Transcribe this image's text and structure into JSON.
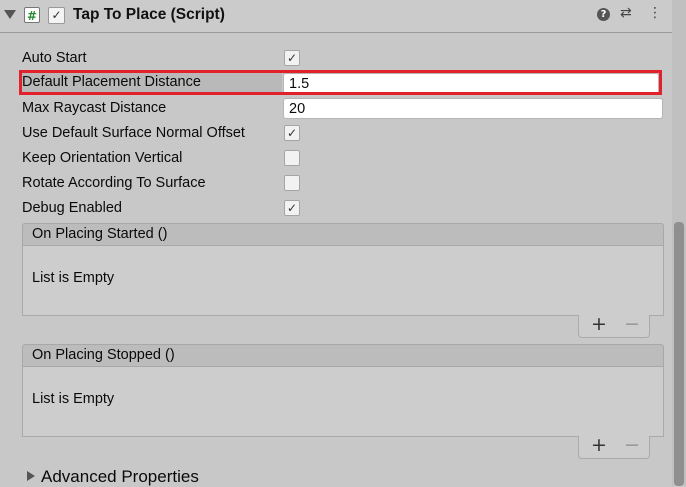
{
  "component": {
    "title": "Tap To Place (Script)",
    "script_icon": "#",
    "enabled": true
  },
  "header_icons": {
    "help": "?",
    "settings": "⇄",
    "menu": "⋮"
  },
  "properties": {
    "auto_start": {
      "label": "Auto Start",
      "checked": true
    },
    "default_placement_distance": {
      "label": "Default Placement Distance",
      "value": "1.5"
    },
    "max_raycast_distance": {
      "label": "Max Raycast Distance",
      "value": "20"
    },
    "use_default_surface_normal_offset": {
      "label": "Use Default Surface Normal Offset",
      "checked": true
    },
    "keep_orientation_vertical": {
      "label": "Keep Orientation Vertical",
      "checked": false
    },
    "rotate_according_to_surface": {
      "label": "Rotate According To Surface",
      "checked": false
    },
    "debug_enabled": {
      "label": "Debug Enabled",
      "checked": true
    }
  },
  "events": [
    {
      "title": "On Placing Started ()",
      "empty_text": "List is Empty",
      "add_label": "+",
      "remove_label": "−"
    },
    {
      "title": "On Placing Stopped ()",
      "empty_text": "List is Empty",
      "add_label": "+",
      "remove_label": "−"
    }
  ],
  "advanced": {
    "label": "Advanced Properties",
    "expanded": false
  },
  "highlight_color": "#e3212c"
}
